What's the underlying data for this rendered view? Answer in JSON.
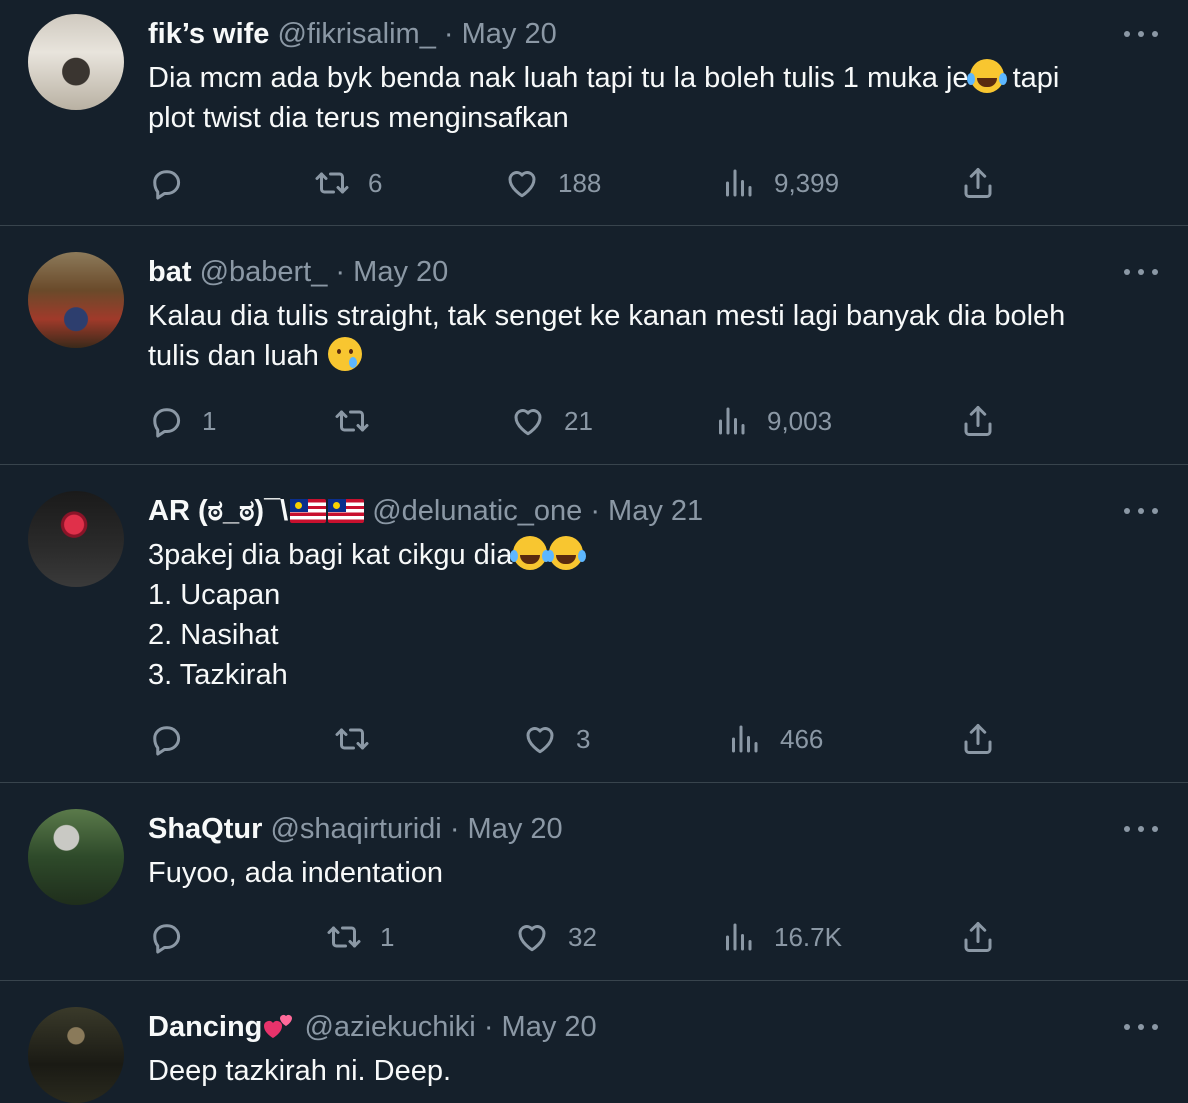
{
  "tweets": [
    {
      "name": "fik’s wife",
      "handle": "@fikrisalim_",
      "sep": "·",
      "date": "May 20",
      "lines": [
        "Dia mcm ada byk benda nak luah tapi tu la boleh tulis 1 muka je",
        " tapi",
        "plot twist dia terus menginsafkan"
      ],
      "emoji_1": "face-with-tears-of-joy",
      "reply_count": "",
      "retweet_count": "6",
      "like_count": "188",
      "view_count": "9,399"
    },
    {
      "name": "bat",
      "handle": "@babert_",
      "sep": "·",
      "date": "May 20",
      "lines": [
        "Kalau dia tulis straight, tak senget ke kanan mesti lagi banyak dia boleh",
        "tulis dan luah "
      ],
      "emoji_1": "smiling-face-with-tear",
      "reply_count": "1",
      "retweet_count": "",
      "like_count": "21",
      "view_count": "9,003"
    },
    {
      "name": "AR (ಠ_ಠ)¯\\",
      "handle": "@delunatic_one",
      "sep": "·",
      "date": "May 21",
      "flags": [
        "malaysia-flag",
        "malaysia-flag"
      ],
      "lines": [
        "3pakej dia bagi kat cikgu dia",
        "1. Ucapan",
        "2. Nasihat",
        "3. Tazkirah"
      ],
      "emoji_1": "face-with-tears-of-joy",
      "reply_count": "",
      "retweet_count": "",
      "like_count": "3",
      "view_count": "466"
    },
    {
      "name": "ShaQtur",
      "handle": "@shaqirturidi",
      "sep": "·",
      "date": "May 20",
      "lines": [
        "Fuyoo, ada indentation"
      ],
      "reply_count": "",
      "retweet_count": "1",
      "like_count": "32",
      "view_count": "16.7K"
    },
    {
      "name": "Dancing",
      "handle": "@aziekuchiki",
      "sep": "·",
      "date": "May 20",
      "name_emoji": "two-hearts",
      "lines": [
        "Deep tazkirah ni. Deep."
      ]
    }
  ],
  "colors": {
    "background": "#15202b",
    "text": "#f7f9f9",
    "muted": "#8b98a5",
    "divider": "#38444d"
  },
  "icons": {
    "reply": "reply-icon",
    "retweet": "retweet-icon",
    "like": "heart-icon",
    "views": "views-icon",
    "share": "share-icon",
    "more": "more-icon"
  }
}
